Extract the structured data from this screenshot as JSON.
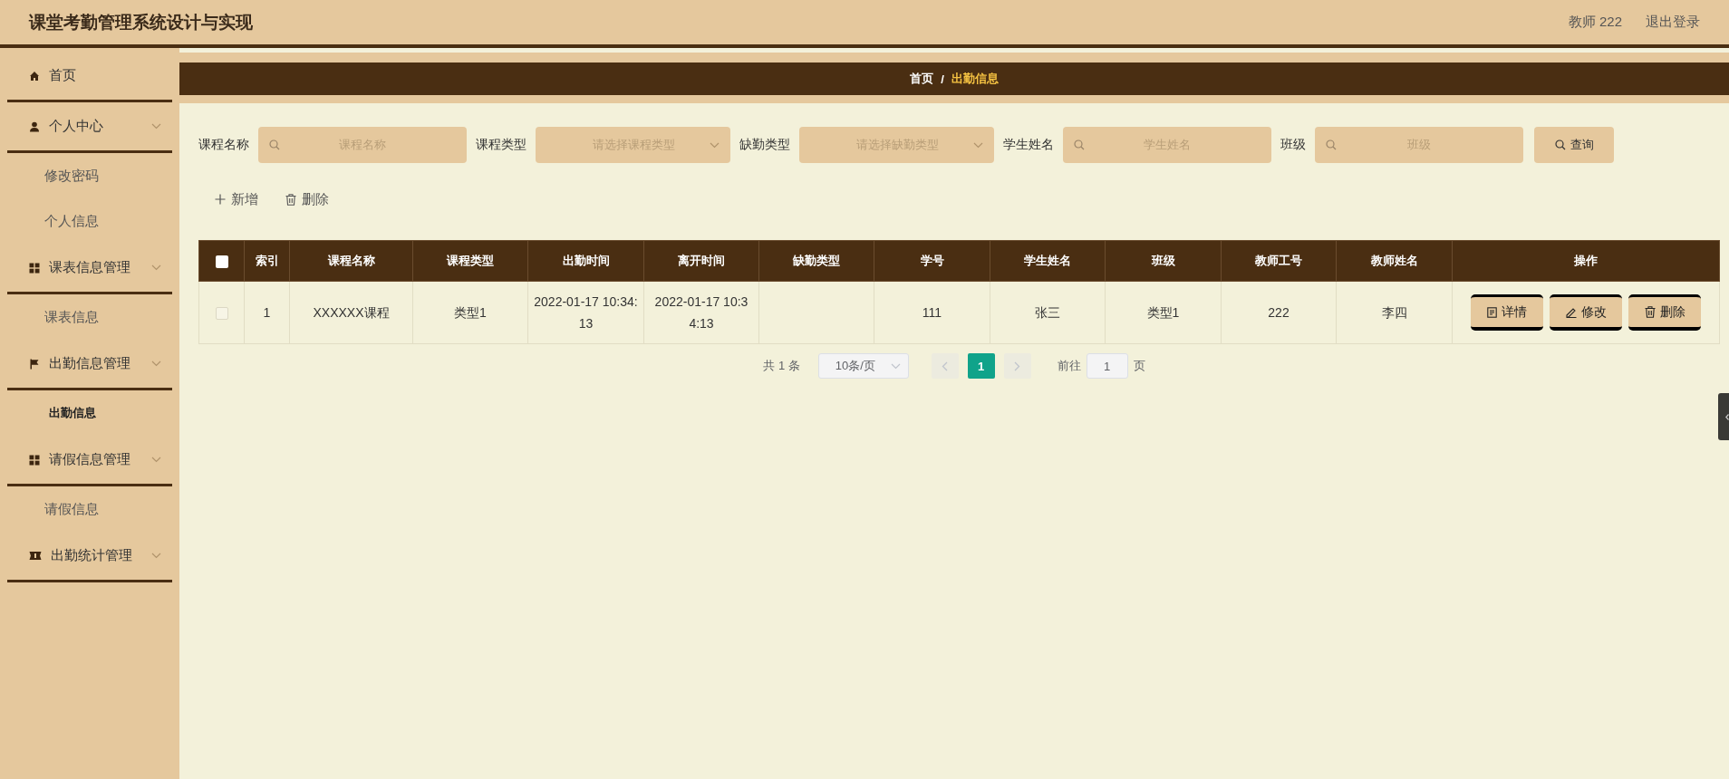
{
  "header": {
    "title": "课堂考勤管理系统设计与实现",
    "user": "教师 222",
    "logout": "退出登录"
  },
  "sidebar": {
    "items": [
      {
        "label": "首页",
        "kind": "home"
      },
      {
        "label": "个人中心",
        "kind": "user",
        "children": [
          {
            "label": "修改密码",
            "selected": false
          },
          {
            "label": "个人信息",
            "selected": false
          }
        ]
      },
      {
        "label": "课表信息管理",
        "kind": "grid",
        "children": [
          {
            "label": "课表信息",
            "selected": false
          }
        ]
      },
      {
        "label": "出勤信息管理",
        "kind": "flag",
        "children": [
          {
            "label": "出勤信息",
            "selected": true
          }
        ]
      },
      {
        "label": "请假信息管理",
        "kind": "grid",
        "children": [
          {
            "label": "请假信息",
            "selected": false
          }
        ]
      },
      {
        "label": "出勤统计管理",
        "kind": "ticket"
      }
    ]
  },
  "breadcrumb": [
    {
      "label": "首页",
      "current": false
    },
    {
      "label": "出勤信息",
      "current": true
    }
  ],
  "breadcrumb_separator": "/",
  "filters": [
    {
      "label": "课程名称",
      "placeholder": "课程名称",
      "kind": "text"
    },
    {
      "label": "课程类型",
      "placeholder": "请选择课程类型",
      "kind": "select"
    },
    {
      "label": "缺勤类型",
      "placeholder": "请选择缺勤类型",
      "kind": "select"
    },
    {
      "label": "学生姓名",
      "placeholder": "学生姓名",
      "kind": "text"
    },
    {
      "label": "班级",
      "placeholder": "班级",
      "kind": "text"
    }
  ],
  "search_button": "查询",
  "actions": [
    {
      "label": "新增",
      "kind": "add"
    },
    {
      "label": "删除",
      "kind": "delete"
    }
  ],
  "table": {
    "header_checked": false,
    "columns": [
      "索引",
      "课程名称",
      "课程类型",
      "出勤时间",
      "离开时间",
      "缺勤类型",
      "学号",
      "学生姓名",
      "班级",
      "教师工号",
      "教师姓名",
      "操作"
    ],
    "rows": [
      {
        "checked": false,
        "cells": [
          "1",
          "XXXXXX课程",
          "类型1",
          "2022-01-17 10:34:13",
          "2022-01-17 10:34:13",
          "",
          "111",
          "张三",
          "类型1",
          "222",
          "李四"
        ],
        "actions": [
          {
            "label": "详情",
            "kind": "detail"
          },
          {
            "label": "修改",
            "kind": "edit"
          },
          {
            "label": "删除",
            "kind": "delete"
          }
        ]
      }
    ]
  },
  "pagination": {
    "total": "共 1 条",
    "page_size": "10条/页",
    "pages": [
      {
        "label": "1",
        "selected": true
      }
    ],
    "goto_label": "前往",
    "goto_value": "1",
    "goto_suffix": "页"
  }
}
